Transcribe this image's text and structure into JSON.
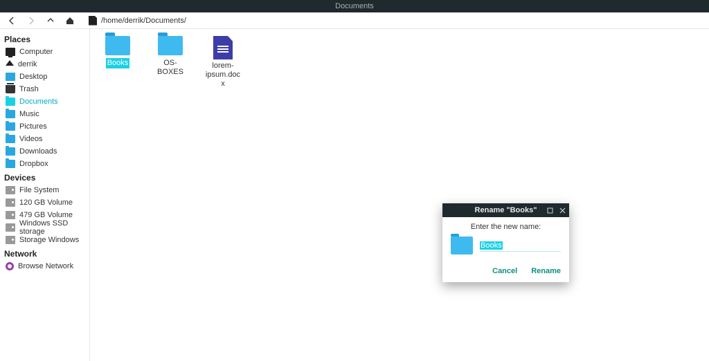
{
  "window": {
    "title": "Documents"
  },
  "toolbar": {
    "path": "/home/derrik/Documents/"
  },
  "sidebar": {
    "sections": [
      {
        "header": "Places",
        "items": [
          {
            "label": "Computer",
            "icon": "monitor",
            "active": false
          },
          {
            "label": "derrik",
            "icon": "home",
            "active": false
          },
          {
            "label": "Desktop",
            "icon": "desktop",
            "active": false
          },
          {
            "label": "Trash",
            "icon": "trash",
            "active": false
          },
          {
            "label": "Documents",
            "icon": "folder",
            "active": true
          },
          {
            "label": "Music",
            "icon": "folder",
            "active": false
          },
          {
            "label": "Pictures",
            "icon": "folder",
            "active": false
          },
          {
            "label": "Videos",
            "icon": "folder",
            "active": false
          },
          {
            "label": "Downloads",
            "icon": "folder",
            "active": false
          },
          {
            "label": "Dropbox",
            "icon": "folder",
            "active": false
          }
        ]
      },
      {
        "header": "Devices",
        "items": [
          {
            "label": "File System",
            "icon": "drive",
            "active": false
          },
          {
            "label": "120 GB Volume",
            "icon": "drive",
            "active": false
          },
          {
            "label": "479 GB Volume",
            "icon": "drive",
            "active": false
          },
          {
            "label": "Windows SSD storage",
            "icon": "drive",
            "active": false
          },
          {
            "label": "Storage Windows",
            "icon": "drive",
            "active": false
          }
        ]
      },
      {
        "header": "Network",
        "items": [
          {
            "label": "Browse Network",
            "icon": "network",
            "active": false
          }
        ]
      }
    ]
  },
  "files": [
    {
      "name": "Books",
      "type": "folder",
      "selected": true
    },
    {
      "name": "OS-BOXES",
      "type": "folder",
      "selected": false
    },
    {
      "name": "lorem-ipsum.docx",
      "type": "doc",
      "selected": false
    }
  ],
  "dialog": {
    "title": "Rename \"Books\"",
    "prompt": "Enter the new name:",
    "value": "Books",
    "cancel_label": "Cancel",
    "confirm_label": "Rename"
  }
}
